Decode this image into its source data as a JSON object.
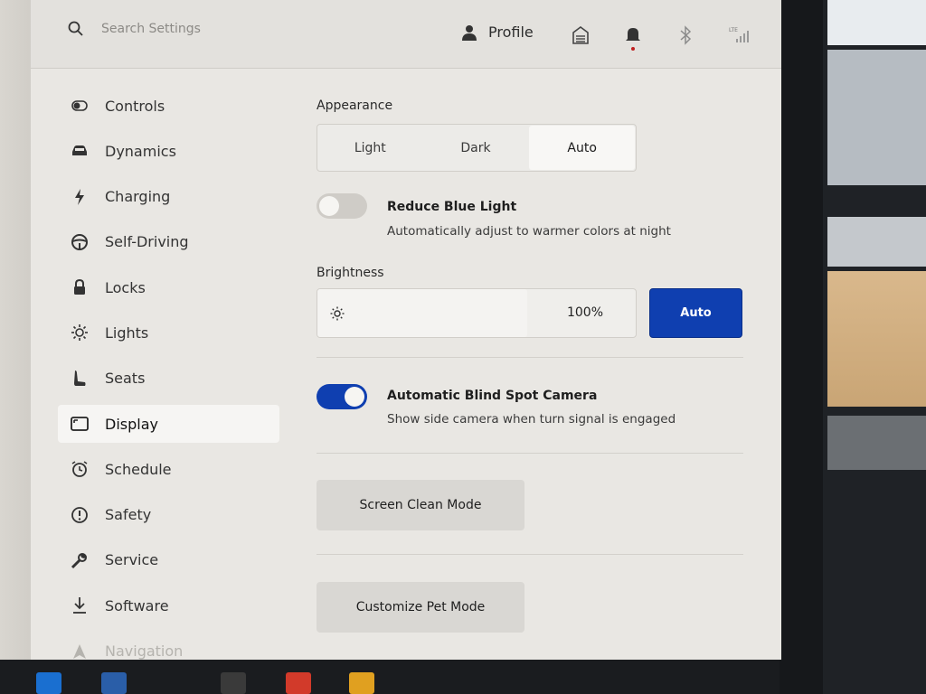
{
  "search": {
    "placeholder": "Search Settings"
  },
  "header": {
    "profile_label": "Profile",
    "lte_label": "LTE"
  },
  "sidebar": {
    "items": [
      {
        "label": "Controls",
        "icon": "toggle-icon"
      },
      {
        "label": "Dynamics",
        "icon": "car-icon"
      },
      {
        "label": "Charging",
        "icon": "bolt-icon"
      },
      {
        "label": "Self-Driving",
        "icon": "steering-wheel-icon"
      },
      {
        "label": "Locks",
        "icon": "lock-icon"
      },
      {
        "label": "Lights",
        "icon": "light-bulb-icon"
      },
      {
        "label": "Seats",
        "icon": "seat-icon"
      },
      {
        "label": "Display",
        "icon": "display-icon",
        "active": true
      },
      {
        "label": "Schedule",
        "icon": "alarm-clock-icon"
      },
      {
        "label": "Safety",
        "icon": "alert-circle-icon"
      },
      {
        "label": "Service",
        "icon": "wrench-icon"
      },
      {
        "label": "Software",
        "icon": "download-icon"
      },
      {
        "label": "Navigation",
        "icon": "navigation-arrow-icon"
      }
    ]
  },
  "display": {
    "appearance_label": "Appearance",
    "appearance_options": [
      "Light",
      "Dark",
      "Auto"
    ],
    "appearance_selected": "Auto",
    "reduce_blue_light": {
      "title": "Reduce Blue Light",
      "subtitle": "Automatically adjust to warmer colors at night",
      "enabled": false
    },
    "brightness": {
      "label": "Brightness",
      "value_text": "100%",
      "level": 0.66,
      "auto_label": "Auto"
    },
    "blind_spot_camera": {
      "title": "Automatic Blind Spot Camera",
      "subtitle": "Show side camera when turn signal is engaged",
      "enabled": true
    },
    "screen_clean_label": "Screen Clean Mode",
    "pet_mode_label": "Customize Pet Mode"
  },
  "colors": {
    "accent": "#0f3fb0",
    "background": "#e9e7e3",
    "active_item_bg": "#f6f5f3"
  }
}
